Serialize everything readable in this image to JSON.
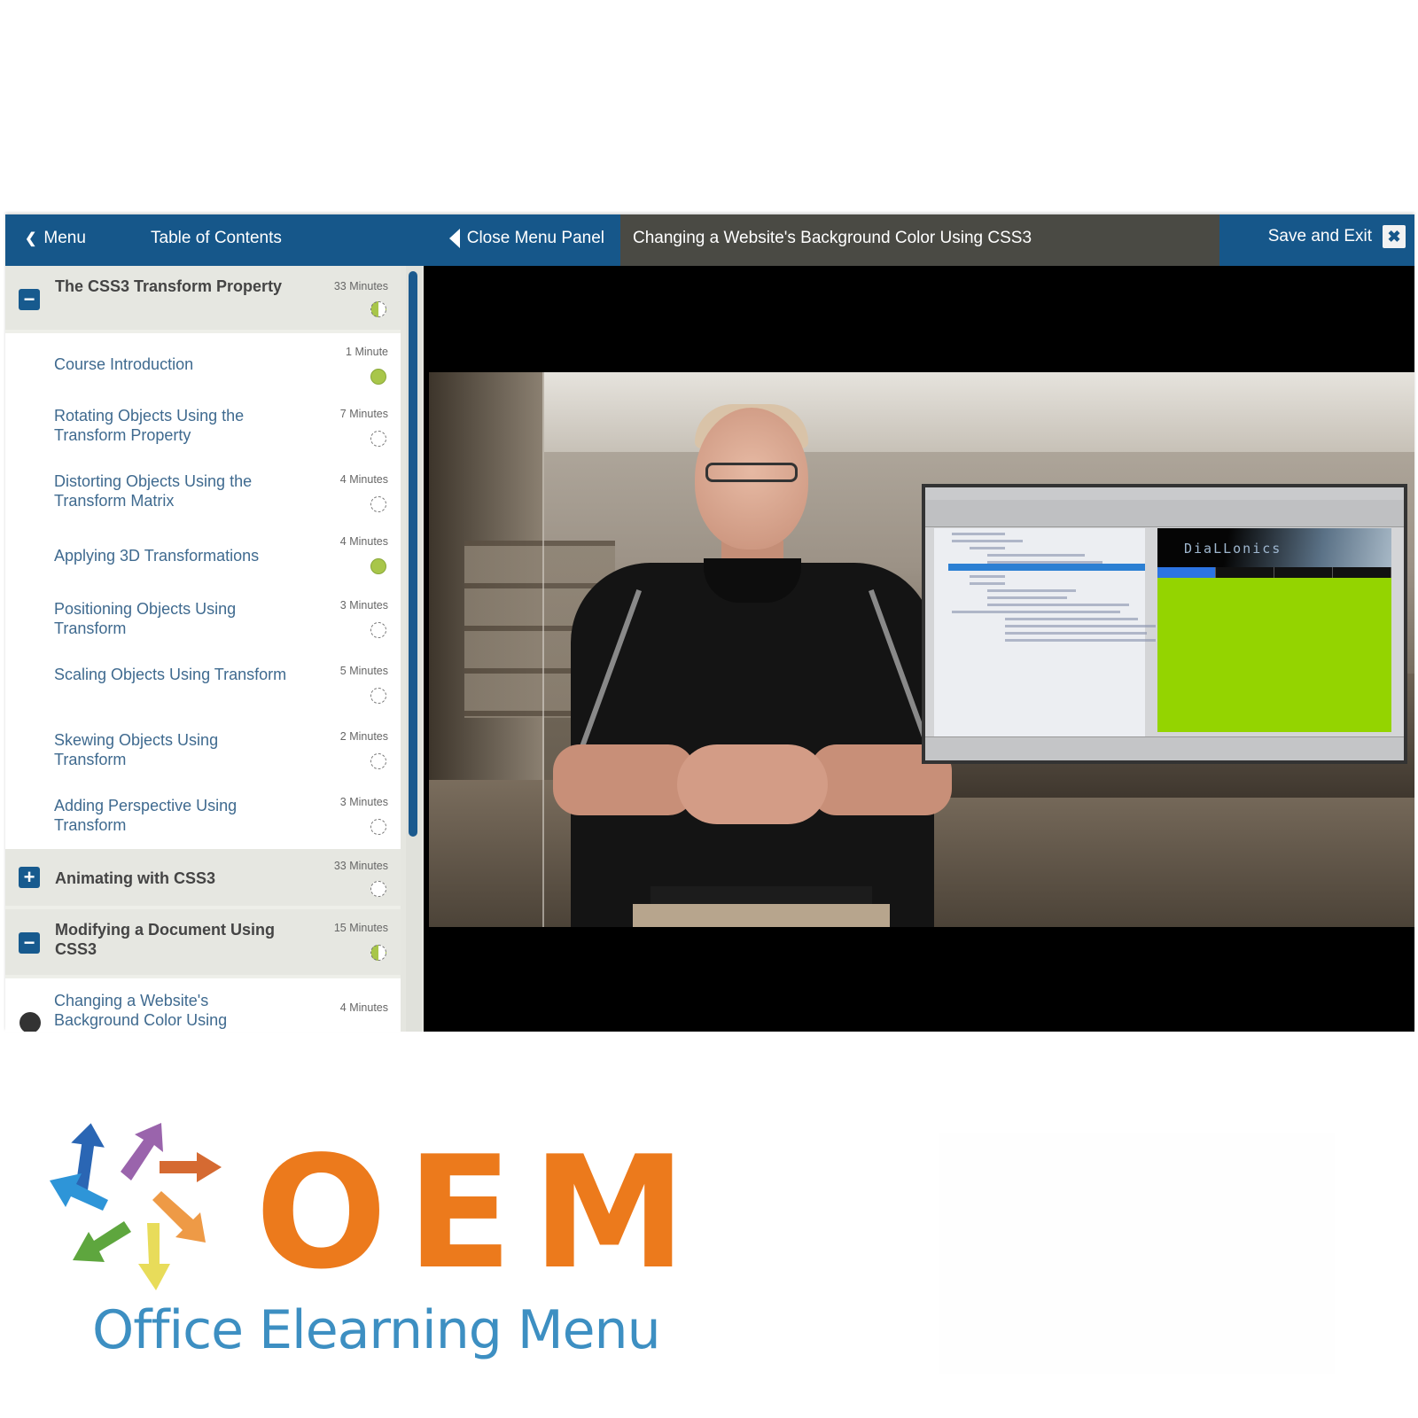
{
  "topbar": {
    "menu_label": "Menu",
    "toc_title": "Table of Contents",
    "close_panel_label": "Close Menu Panel",
    "lesson_title": "Changing a Website's Background Color Using CSS3",
    "save_exit_label": "Save and Exit",
    "close_icon_glyph": "✖"
  },
  "toc": {
    "sections": [
      {
        "title": "The CSS3 Transform Property",
        "duration": "33 Minutes",
        "expanded": true,
        "toggle_glyph": "−",
        "progress": "partial",
        "lessons": [
          {
            "title": "Course Introduction",
            "duration": "1 Minute",
            "status": "complete"
          },
          {
            "title": "Rotating Objects Using the Transform Property",
            "duration": "7 Minutes",
            "status": "not-started"
          },
          {
            "title": "Distorting Objects Using the Transform Matrix",
            "duration": "4 Minutes",
            "status": "not-started"
          },
          {
            "title": "Applying 3D Transformations",
            "duration": "4 Minutes",
            "status": "complete"
          },
          {
            "title": "Positioning Objects Using Transform",
            "duration": "3 Minutes",
            "status": "not-started"
          },
          {
            "title": "Scaling Objects Using Transform",
            "duration": "5 Minutes",
            "status": "not-started"
          },
          {
            "title": "Skewing Objects Using Transform",
            "duration": "2 Minutes",
            "status": "not-started"
          },
          {
            "title": "Adding Perspective Using Transform",
            "duration": "3 Minutes",
            "status": "not-started"
          }
        ]
      },
      {
        "title": "Animating with CSS3",
        "duration": "33 Minutes",
        "expanded": false,
        "toggle_glyph": "+",
        "progress": "not-started"
      },
      {
        "title": "Modifying a Document Using CSS3",
        "duration": "15 Minutes",
        "expanded": true,
        "toggle_glyph": "−",
        "progress": "partial",
        "lessons": [
          {
            "title": "Changing a Website's Background Color Using",
            "duration": "4 Minutes",
            "status": "current"
          }
        ]
      }
    ]
  },
  "video": {
    "preview_site_logo": "DiaLLonics"
  },
  "branding": {
    "logo_letters": "OEM",
    "logo_text": "Office Elearning Menu",
    "logo_color": "#ec7a1c",
    "text_color": "#3d8fc2"
  },
  "colors": {
    "header_blue": "#16578a",
    "title_bar_gray": "#4a4a44",
    "complete_green": "#a8c64a",
    "lesson_link": "#3f6a8f"
  }
}
